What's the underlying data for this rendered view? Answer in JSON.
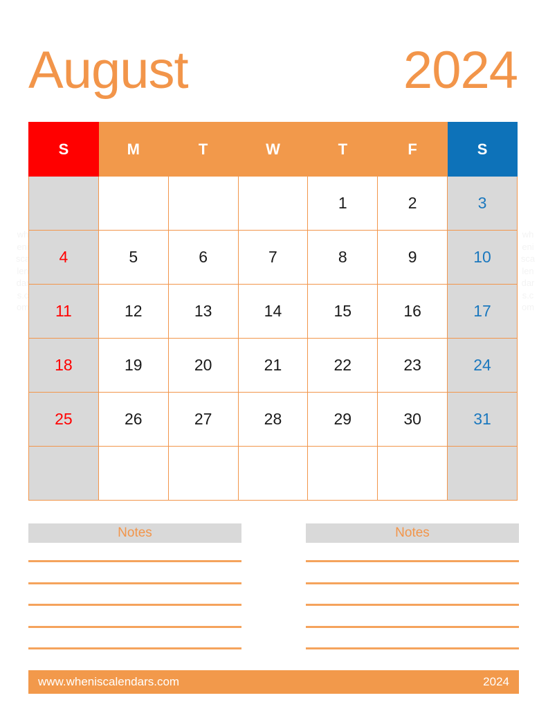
{
  "title": {
    "month": "August",
    "year": "2024"
  },
  "watermark": {
    "text": "wheniscalendars.com"
  },
  "calendar": {
    "weekday_headers": [
      "S",
      "M",
      "T",
      "W",
      "T",
      "F",
      "S"
    ],
    "weeks": [
      [
        "",
        "",
        "",
        "",
        "1",
        "2",
        "3"
      ],
      [
        "4",
        "5",
        "6",
        "7",
        "8",
        "9",
        "10"
      ],
      [
        "11",
        "12",
        "13",
        "14",
        "15",
        "16",
        "17"
      ],
      [
        "18",
        "19",
        "20",
        "21",
        "22",
        "23",
        "24"
      ],
      [
        "25",
        "26",
        "27",
        "28",
        "29",
        "30",
        "31"
      ],
      [
        "",
        "",
        "",
        "",
        "",
        "",
        ""
      ]
    ]
  },
  "notes": {
    "left_label": "Notes",
    "right_label": "Notes",
    "line_count": 5
  },
  "footer": {
    "site": "www.wheniscalendars.com",
    "year": "2024"
  },
  "colors": {
    "orange": "#F2994B",
    "orange_title": "#F2954A",
    "sunday_red": "#FF0000",
    "saturday_blue": "#0D72B9",
    "saturday_text_blue": "#1B78BE",
    "weekend_cell_gray": "#D9D9D9",
    "rule_orange": "#F5A35C",
    "day_text": "#1A1A1A"
  }
}
